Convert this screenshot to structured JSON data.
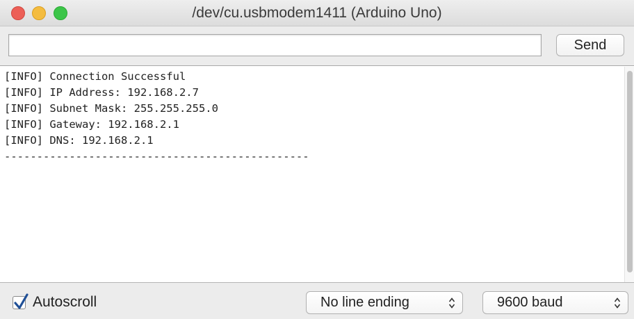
{
  "window": {
    "title": "/dev/cu.usbmodem1411 (Arduino Uno)"
  },
  "toolbar": {
    "input_value": "",
    "send_label": "Send"
  },
  "console": {
    "lines": [
      "[INFO] Connection Successful",
      "[INFO] IP Address: 192.168.2.7",
      "[INFO] Subnet Mask: 255.255.255.0",
      "[INFO] Gateway: 192.168.2.1",
      "[INFO] DNS: 192.168.2.1",
      "-----------------------------------------------"
    ]
  },
  "footer": {
    "autoscroll_label": "Autoscroll",
    "autoscroll_checked": true,
    "line_ending": "No line ending",
    "baud_rate": "9600 baud"
  },
  "icons": {
    "close": "close-window-icon",
    "minimize": "minimize-window-icon",
    "maximize": "maximize-window-icon",
    "check": "checkmark-icon",
    "select": "up-down-arrows-icon"
  },
  "colors": {
    "close": "#ec5f57",
    "minimize": "#f4bc3f",
    "maximize": "#3cc549",
    "check": "#1f4f96"
  }
}
